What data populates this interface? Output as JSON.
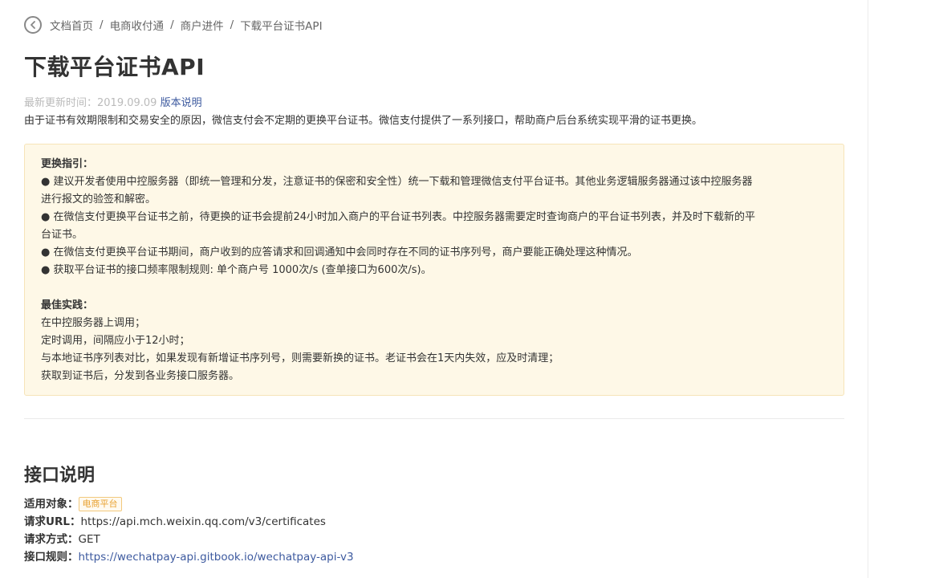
{
  "breadcrumb": {
    "items": [
      "文档首页",
      "电商收付通",
      "商户进件",
      "下载平台证书API"
    ],
    "separator": "/"
  },
  "page": {
    "title": "下载平台证书API",
    "updated_label": "最新更新时间：2019.09.09",
    "version_link": "版本说明",
    "intro": "由于证书有效期限制和交易安全的原因，微信支付会不定期的更换平台证书。微信支付提供了一系列接口，帮助商户后台系统实现平滑的证书更换。"
  },
  "notice": {
    "guide_title": "更换指引：",
    "guide_lines": [
      "● 建议开发者使用中控服务器（即统一管理和分发，注意证书的保密和安全性）统一下载和管理微信支付平台证书。其他业务逻辑服务器通过该中控服务器",
      "进行报文的验签和解密。",
      "● 在微信支付更换平台证书之前，待更换的证书会提前24小时加入商户的平台证书列表。中控服务器需要定时查询商户的平台证书列表，并及时下载新的平",
      "台证书。",
      "● 在微信支付更换平台证书期间，商户收到的应答请求和回调通知中会同时存在不同的证书序列号，商户要能正确处理这种情况。",
      "● 获取平台证书的接口频率限制规则: 单个商户号 1000次/s (查单接口为600次/s)。"
    ],
    "practice_title": "最佳实践：",
    "practice_lines": [
      "在中控服务器上调用；",
      "定时调用，间隔应小于12小时；",
      "与本地证书序列表对比，如果发现有新增证书序列号，则需要新换的证书。老证书会在1天内失效，应及时清理；",
      "获取到证书后，分发到各业务接口服务器。"
    ]
  },
  "api": {
    "section_title": "接口说明",
    "target_label": "适用对象：",
    "target_tag": "电商平台",
    "url_label": "请求URL：",
    "url_value": "https://api.mch.weixin.qq.com/v3/certificates",
    "method_label": "请求方式：",
    "method_value": "GET",
    "rules_label": "接口规则：",
    "rules_link": "https://wechatpay-api.gitbook.io/wechatpay-api-v3"
  },
  "colors": {
    "link": "#3d5a9f",
    "notice_bg": "#fef8e7",
    "notice_border": "#f6e4b8",
    "tag": "#e8a130"
  }
}
